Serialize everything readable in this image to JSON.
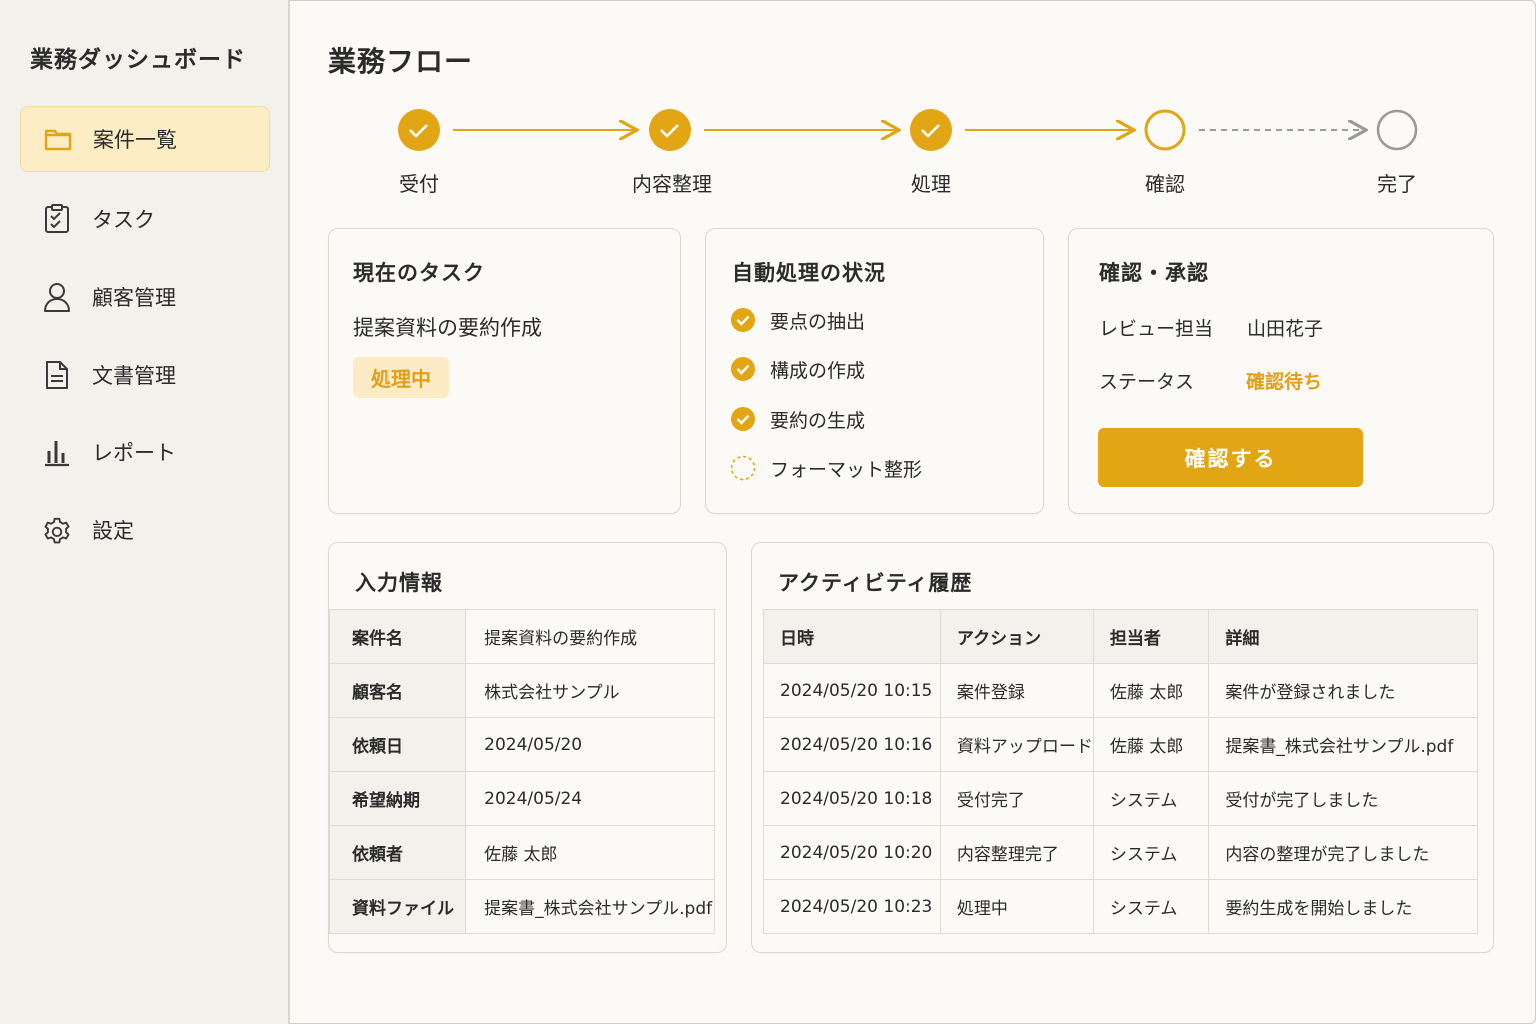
{
  "sidebar": {
    "app_title": "業務ダッシュボード",
    "items": [
      {
        "label": "案件一覧",
        "icon": "folder-icon",
        "active": true
      },
      {
        "label": "タスク",
        "icon": "task-checklist-icon",
        "active": false
      },
      {
        "label": "顧客管理",
        "icon": "user-icon",
        "active": false
      },
      {
        "label": "文書管理",
        "icon": "document-icon",
        "active": false
      },
      {
        "label": "レポート",
        "icon": "bar-chart-icon",
        "active": false
      },
      {
        "label": "設定",
        "icon": "gear-icon",
        "active": false
      }
    ]
  },
  "main": {
    "title": "業務フロー",
    "steps": [
      {
        "label": "受付",
        "status": "done"
      },
      {
        "label": "内容整理",
        "status": "done"
      },
      {
        "label": "処理",
        "status": "done"
      },
      {
        "label": "確認",
        "status": "current"
      },
      {
        "label": "完了",
        "status": "pending"
      }
    ]
  },
  "current_task": {
    "title": "現在のタスク",
    "task_name": "提案資料の要約作成",
    "status_badge": "処理中"
  },
  "auto_process": {
    "title": "自動処理の状況",
    "items": [
      {
        "label": "要点の抽出",
        "done": true
      },
      {
        "label": "構成の作成",
        "done": true
      },
      {
        "label": "要約の生成",
        "done": true
      },
      {
        "label": "フォーマット整形",
        "done": false
      }
    ]
  },
  "approval": {
    "title": "確認・承認",
    "reviewer_key": "レビュー担当",
    "reviewer_value": "山田花子",
    "status_key": "ステータス",
    "status_value": "確認待ち",
    "button_label": "確認する"
  },
  "input_info": {
    "title": "入力情報",
    "rows": [
      {
        "key": "案件名",
        "value": "提案資料の要約作成"
      },
      {
        "key": "顧客名",
        "value": "株式会社サンプル"
      },
      {
        "key": "依頼日",
        "value": "2024/05/20"
      },
      {
        "key": "希望納期",
        "value": "2024/05/24"
      },
      {
        "key": "依頼者",
        "value": "佐藤 太郎"
      },
      {
        "key": "資料ファイル",
        "value": "提案書_株式会社サンプル.pdf"
      }
    ]
  },
  "activity": {
    "title": "アクティビティ履歴",
    "headers": [
      "日時",
      "アクション",
      "担当者",
      "詳細"
    ],
    "rows": [
      [
        "2024/05/20 10:15",
        "案件登録",
        "佐藤 太郎",
        "案件が登録されました"
      ],
      [
        "2024/05/20 10:16",
        "資料アップロード",
        "佐藤 太郎",
        "提案書_株式会社サンプル.pdf"
      ],
      [
        "2024/05/20 10:18",
        "受付完了",
        "システム",
        "受付が完了しました"
      ],
      [
        "2024/05/20 10:20",
        "内容整理完了",
        "システム",
        "内容の整理が完了しました"
      ],
      [
        "2024/05/20 10:23",
        "処理中",
        "システム",
        "要約生成を開始しました"
      ]
    ]
  },
  "colors": {
    "accent": "#e2a514",
    "accent_light": "#fcedc5",
    "pending": "#9a9a9a"
  }
}
